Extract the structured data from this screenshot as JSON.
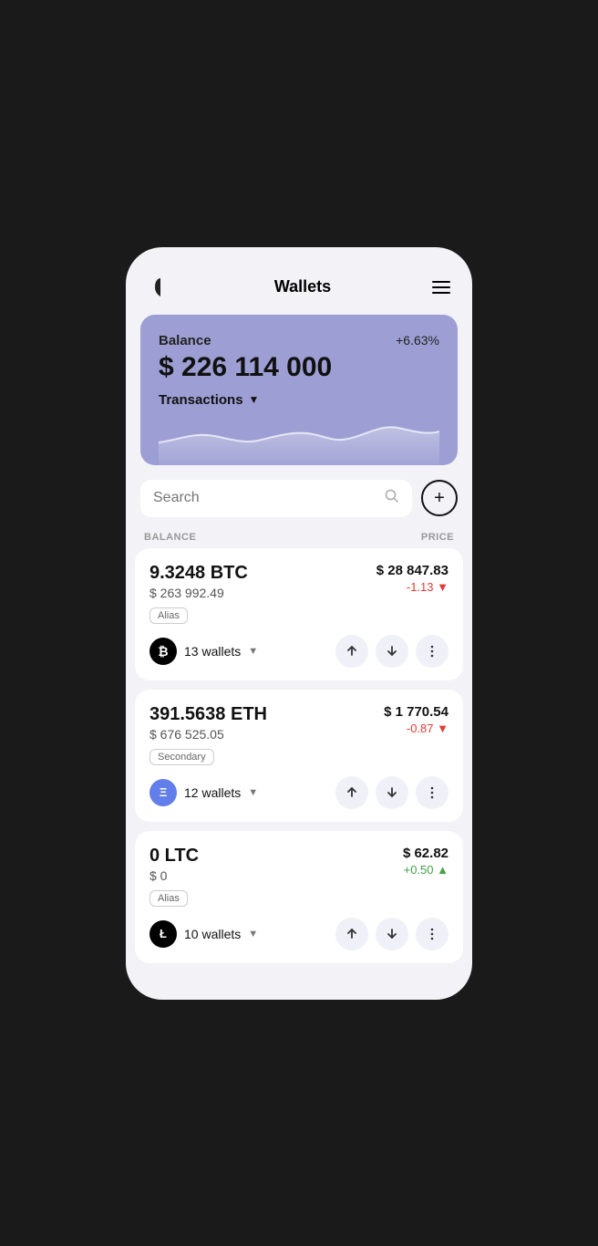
{
  "app": {
    "title": "Wallets"
  },
  "header": {
    "logo_alt": "app-logo",
    "menu_label": "menu"
  },
  "balance_card": {
    "label": "Balance",
    "percent": "+6.63%",
    "amount": "$ 226 114 000",
    "transactions_label": "Transactions"
  },
  "search": {
    "placeholder": "Search"
  },
  "columns": {
    "balance": "BALANCE",
    "price": "PRICE"
  },
  "coins": [
    {
      "id": "btc",
      "name": "9.3248 BTC",
      "usd": "$ 263 992.49",
      "badge": "Alias",
      "price": "$ 28 847.83",
      "change": "-1.13",
      "change_direction": "down",
      "wallets_count": "13 wallets",
      "icon_symbol": "₿"
    },
    {
      "id": "eth",
      "name": "391.5638 ETH",
      "usd": "$ 676 525.05",
      "badge": "Secondary",
      "price": "$ 1 770.54",
      "change": "-0.87",
      "change_direction": "down",
      "wallets_count": "12 wallets",
      "icon_symbol": "Ξ"
    },
    {
      "id": "ltc",
      "name": "0 LTC",
      "usd": "$ 0",
      "badge": "Alias",
      "price": "$ 62.82",
      "change": "+0.50",
      "change_direction": "up",
      "wallets_count": "10 wallets",
      "icon_symbol": "Ł"
    }
  ],
  "actions": {
    "send_label": "send",
    "receive_label": "receive",
    "more_label": "more"
  }
}
